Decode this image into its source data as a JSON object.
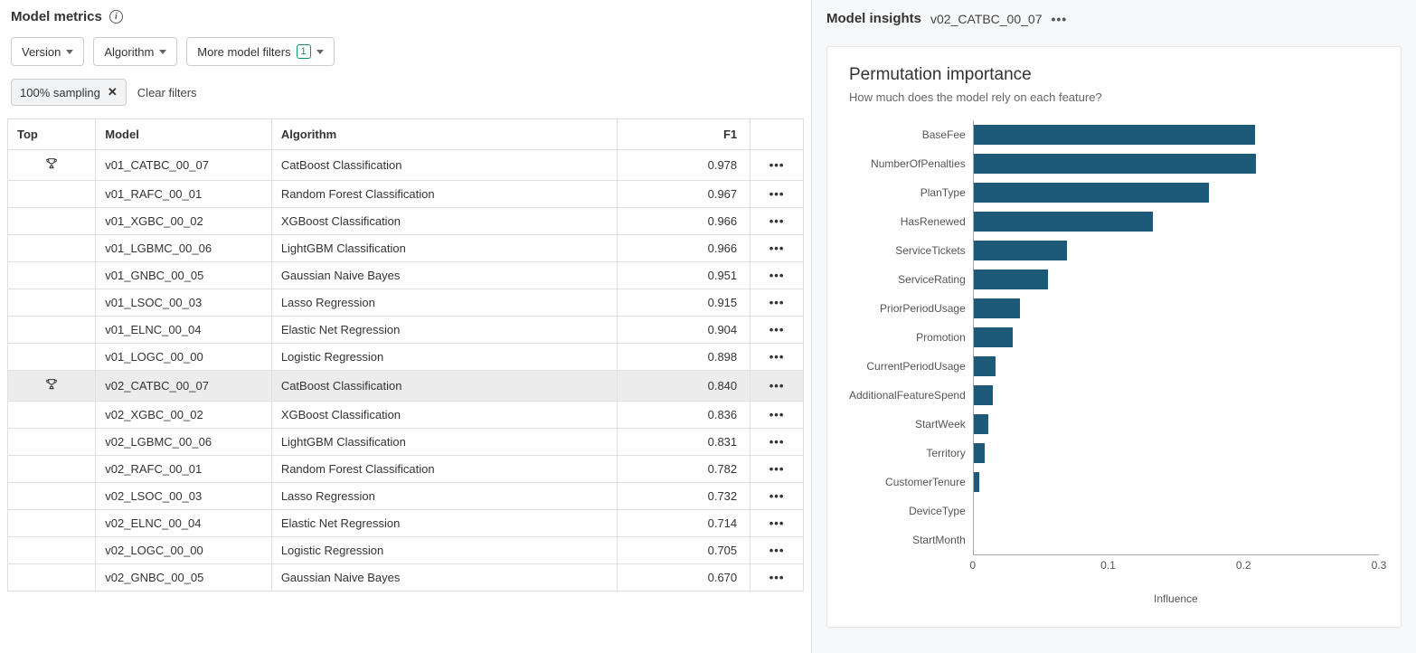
{
  "metrics": {
    "title": "Model metrics",
    "filters": {
      "version_label": "Version",
      "algorithm_label": "Algorithm",
      "more_label": "More model filters",
      "more_count": "1"
    },
    "chips": {
      "sampling": "100% sampling"
    },
    "clear_filters": "Clear filters",
    "columns": {
      "top": "Top",
      "model": "Model",
      "algorithm": "Algorithm",
      "f1": "F1"
    },
    "rows": [
      {
        "top": true,
        "model": "v01_CATBC_00_07",
        "algorithm": "CatBoost Classification",
        "f1": "0.978",
        "selected": false
      },
      {
        "top": false,
        "model": "v01_RAFC_00_01",
        "algorithm": "Random Forest Classification",
        "f1": "0.967",
        "selected": false
      },
      {
        "top": false,
        "model": "v01_XGBC_00_02",
        "algorithm": "XGBoost Classification",
        "f1": "0.966",
        "selected": false
      },
      {
        "top": false,
        "model": "v01_LGBMC_00_06",
        "algorithm": "LightGBM Classification",
        "f1": "0.966",
        "selected": false
      },
      {
        "top": false,
        "model": "v01_GNBC_00_05",
        "algorithm": "Gaussian Naive Bayes",
        "f1": "0.951",
        "selected": false
      },
      {
        "top": false,
        "model": "v01_LSOC_00_03",
        "algorithm": "Lasso Regression",
        "f1": "0.915",
        "selected": false
      },
      {
        "top": false,
        "model": "v01_ELNC_00_04",
        "algorithm": "Elastic Net Regression",
        "f1": "0.904",
        "selected": false
      },
      {
        "top": false,
        "model": "v01_LOGC_00_00",
        "algorithm": "Logistic Regression",
        "f1": "0.898",
        "selected": false
      },
      {
        "top": true,
        "model": "v02_CATBC_00_07",
        "algorithm": "CatBoost Classification",
        "f1": "0.840",
        "selected": true
      },
      {
        "top": false,
        "model": "v02_XGBC_00_02",
        "algorithm": "XGBoost Classification",
        "f1": "0.836",
        "selected": false
      },
      {
        "top": false,
        "model": "v02_LGBMC_00_06",
        "algorithm": "LightGBM Classification",
        "f1": "0.831",
        "selected": false
      },
      {
        "top": false,
        "model": "v02_RAFC_00_01",
        "algorithm": "Random Forest Classification",
        "f1": "0.782",
        "selected": false
      },
      {
        "top": false,
        "model": "v02_LSOC_00_03",
        "algorithm": "Lasso Regression",
        "f1": "0.732",
        "selected": false
      },
      {
        "top": false,
        "model": "v02_ELNC_00_04",
        "algorithm": "Elastic Net Regression",
        "f1": "0.714",
        "selected": false
      },
      {
        "top": false,
        "model": "v02_LOGC_00_00",
        "algorithm": "Logistic Regression",
        "f1": "0.705",
        "selected": false
      },
      {
        "top": false,
        "model": "v02_GNBC_00_05",
        "algorithm": "Gaussian Naive Bayes",
        "f1": "0.670",
        "selected": false
      }
    ]
  },
  "insights": {
    "title": "Model insights",
    "model_name": "v02_CATBC_00_07",
    "chart_title": "Permutation importance",
    "chart_subtitle": "How much does the model rely on each feature?",
    "x_label": "Influence"
  },
  "chart_data": {
    "type": "bar",
    "title": "Permutation importance",
    "xlabel": "Influence",
    "ylabel": "",
    "xlim": [
      0,
      0.3
    ],
    "x_ticks": [
      0,
      0.1,
      0.2,
      0.3
    ],
    "categories": [
      "BaseFee",
      "NumberOfPenalties",
      "PlanType",
      "HasRenewed",
      "ServiceTickets",
      "ServiceRating",
      "PriorPeriodUsage",
      "Promotion",
      "CurrentPeriodUsage",
      "AdditionalFeatureSpend",
      "StartWeek",
      "Territory",
      "CustomerTenure",
      "DeviceType",
      "StartMonth"
    ],
    "values": [
      0.208,
      0.209,
      0.174,
      0.133,
      0.069,
      0.055,
      0.034,
      0.029,
      0.016,
      0.014,
      0.011,
      0.008,
      0.004,
      0.0,
      0.0
    ]
  }
}
